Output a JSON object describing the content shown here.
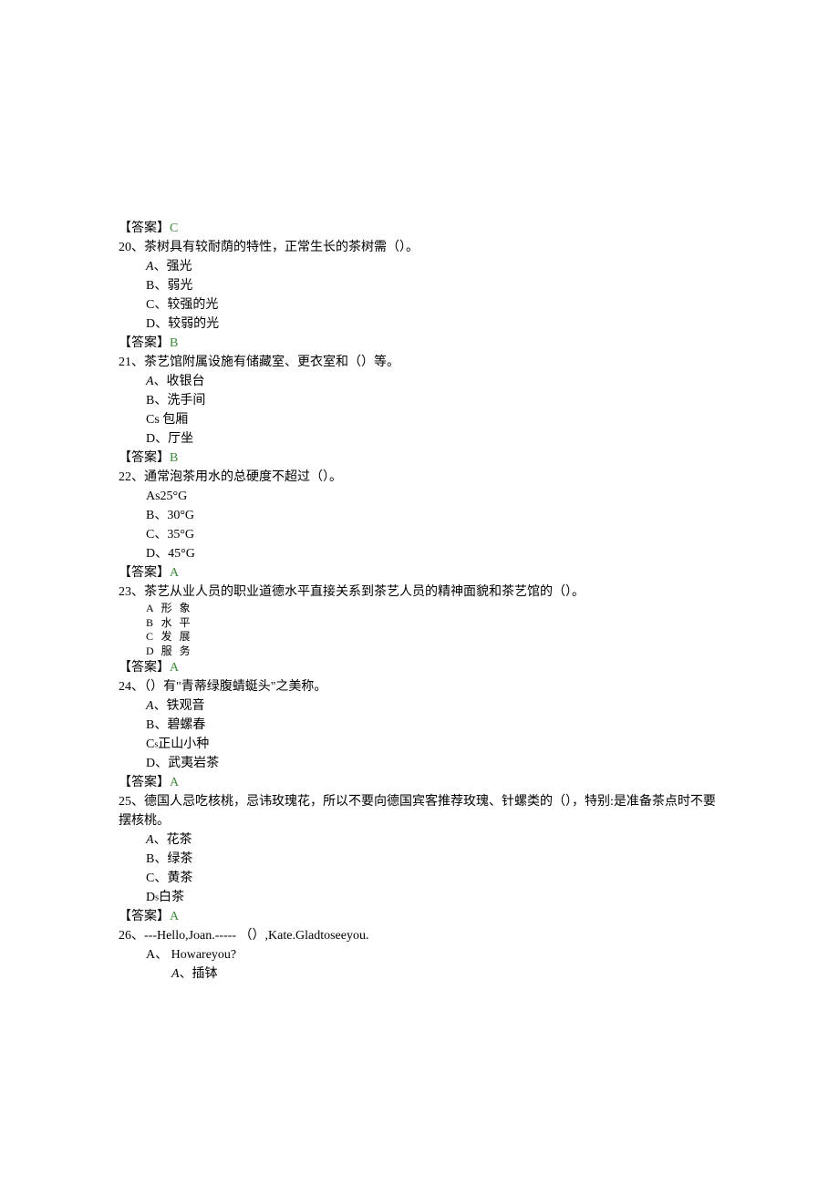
{
  "answers": {
    "prefix": "【答案】",
    "q19": "C",
    "q20": "B",
    "q21": "B",
    "q22": "A",
    "q23": "A",
    "q24": "A",
    "q25": "A"
  },
  "q20": {
    "text": "20、茶树具有较耐荫的特性，正常生长的茶树需（）。",
    "a_label": "A",
    "a_text": "、强光",
    "b": "B、弱光",
    "c": "C、较强的光",
    "d": "D、较弱的光"
  },
  "q21": {
    "text": "21、茶艺馆附属设施有储藏室、更衣室和（）等。",
    "a_label": "A",
    "a_text": "、收银台",
    "b": "B、洗手间",
    "c": "Cs 包厢",
    "d": "D、厅坐"
  },
  "q22": {
    "text": "22、通常泡茶用水的总硬度不超过（）。",
    "a": "As25°G",
    "b": "B、30°G",
    "c": "C、35°G",
    "d": "D、45°G"
  },
  "q23": {
    "text": "23、茶艺从业人员的职业道德水平直接关系到茶艺人员的精神面貌和茶艺馆的（）。",
    "labels": [
      "A",
      "B",
      "C",
      "D"
    ],
    "opts": [
      "形象",
      "水平",
      "发展",
      "服务"
    ]
  },
  "q24": {
    "text": "24、（）有\"青蒂绿腹蜻蜓头\"之美称。",
    "a_label": "A",
    "a_text": "、铁观音",
    "b": "B、碧螺春",
    "c": "C",
    "c_sub": "s",
    "c_text": "正山小种",
    "d": "D、武夷岩茶"
  },
  "q25": {
    "text": "25、德国人忌吃核桃，忌讳玫瑰花，所以不要向德国宾客推荐玫瑰、针螺类的（），特别:是准备茶点时不要摆核桃。",
    "a_label": "A",
    "a_text": "、花茶",
    "b": "B、绿茶",
    "c": "C、黄茶",
    "d": "D",
    "d_sub": "s",
    "d_text": "白茶"
  },
  "q26": {
    "text": "26、---Hello,Joan.----- （）,Kate.Gladtoseeyou.",
    "a": "A、 Howareyou?",
    "sub_a_label": "A",
    "sub_a_text": "、插钵"
  }
}
